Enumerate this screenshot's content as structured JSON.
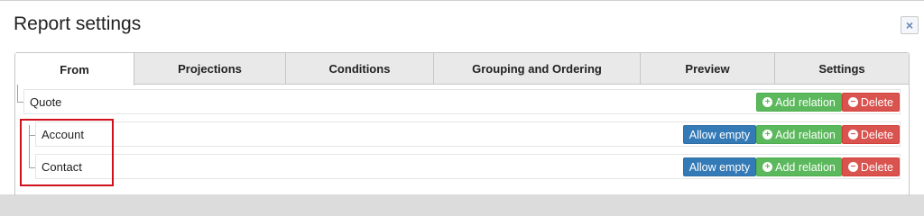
{
  "dialog": {
    "title": "Report settings",
    "close_label": "×"
  },
  "tabs": [
    {
      "label": "From"
    },
    {
      "label": "Projections"
    },
    {
      "label": "Conditions"
    },
    {
      "label": "Grouping and Ordering"
    },
    {
      "label": "Preview"
    },
    {
      "label": "Settings"
    }
  ],
  "tree": {
    "rows": [
      {
        "label": "Quote",
        "allow_empty": "",
        "add_relation": "Add relation",
        "delete": "Delete"
      },
      {
        "label": "Account",
        "allow_empty": "Allow empty",
        "add_relation": "Add relation",
        "delete": "Delete"
      },
      {
        "label": "Contact",
        "allow_empty": "Allow empty",
        "add_relation": "Add relation",
        "delete": "Delete"
      }
    ]
  },
  "icons": {
    "add": "plus-circle-icon",
    "delete": "minus-circle-icon",
    "close": "close-icon"
  },
  "colors": {
    "allow_empty": "#337ab7",
    "add_relation": "#5cb85c",
    "delete": "#d9534f",
    "highlight": "#d0101a"
  }
}
